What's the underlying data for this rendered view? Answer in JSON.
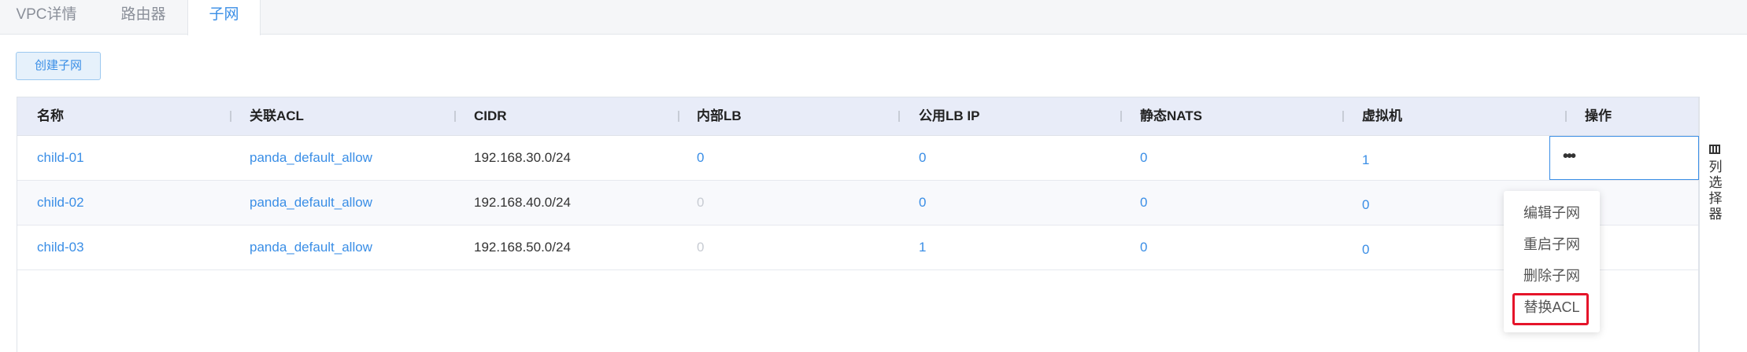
{
  "tabs": [
    {
      "label": "VPC详情",
      "active": false
    },
    {
      "label": "路由器",
      "active": false
    },
    {
      "label": "子网",
      "active": true
    }
  ],
  "toolbar": {
    "create_label": "创建子网"
  },
  "table": {
    "headers": [
      "名称",
      "关联ACL",
      "CIDR",
      "内部LB",
      "公用LB IP",
      "静态NATS",
      "虚拟机",
      "操作"
    ],
    "rows": [
      {
        "name": "child-01",
        "acl": "panda_default_allow",
        "cidr": "192.168.30.0/24",
        "internal_lb": "0",
        "public_lb_ip": "0",
        "static_nats": "0",
        "vms": "1",
        "op": "•••"
      },
      {
        "name": "child-02",
        "acl": "panda_default_allow",
        "cidr": "192.168.40.0/24",
        "internal_lb": "0",
        "public_lb_ip": "0",
        "static_nats": "0",
        "vms": "0"
      },
      {
        "name": "child-03",
        "acl": "panda_default_allow",
        "cidr": "192.168.50.0/24",
        "internal_lb": "0",
        "public_lb_ip": "1",
        "static_nats": "0",
        "vms": "0"
      }
    ]
  },
  "column_chooser": {
    "label": "列选择器",
    "icon": "columns-icon"
  },
  "menu": {
    "items": [
      "编辑子网",
      "重启子网",
      "删除子网",
      "替换ACL"
    ],
    "highlighted": "替换ACL"
  },
  "colors": {
    "accent": "#3a8ee6",
    "highlight": "#e5142a",
    "header_bg": "#e8ecf8"
  }
}
